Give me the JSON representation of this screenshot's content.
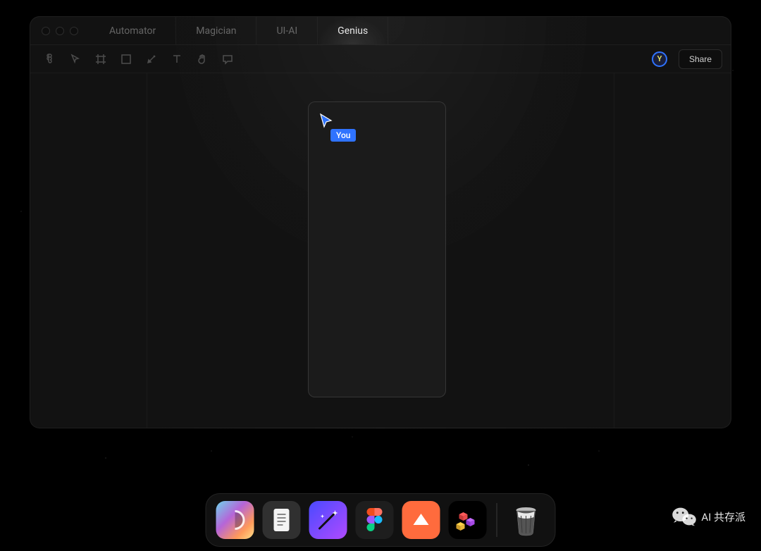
{
  "tabs": [
    "Automator",
    "Magician",
    "UI-AI",
    "Genius"
  ],
  "active_tab_index": 3,
  "toolbar": {
    "share_label": "Share",
    "avatar_letter": "Y"
  },
  "cursor": {
    "label": "You",
    "color": "#2f73ff"
  },
  "dock": {
    "items": [
      {
        "name": "display-gradient-app"
      },
      {
        "name": "notes-app"
      },
      {
        "name": "wand-ai-app"
      },
      {
        "name": "figma-app"
      },
      {
        "name": "triangle-app"
      },
      {
        "name": "cubes-app"
      }
    ],
    "trash": "trash"
  },
  "watermark": {
    "text": "AI 共存派",
    "icon": "wechat"
  }
}
